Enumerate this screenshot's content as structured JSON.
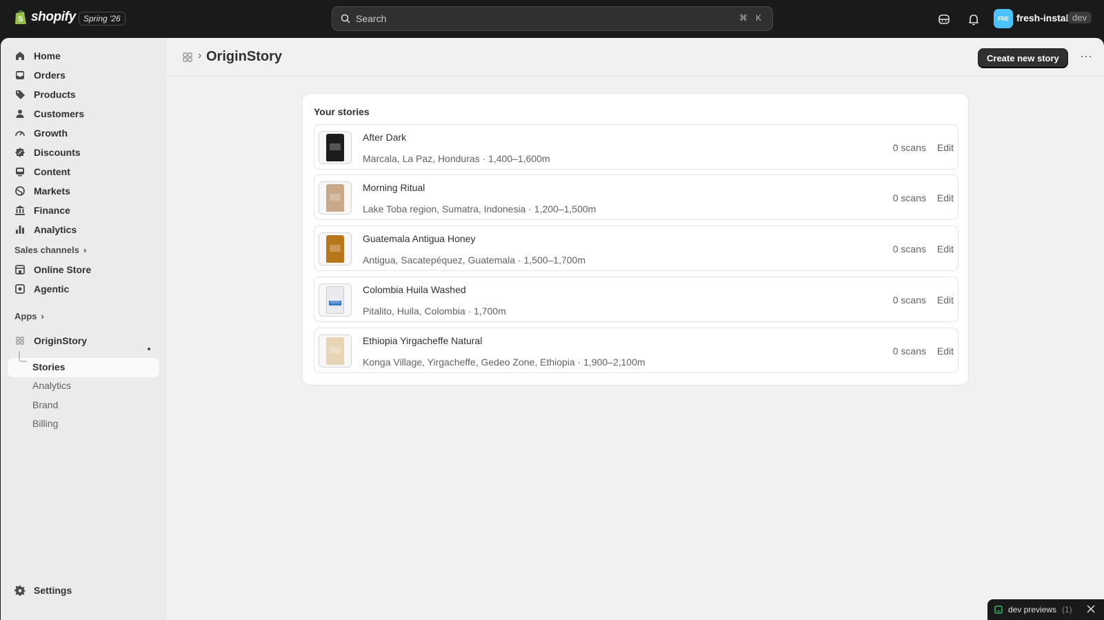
{
  "topbar": {
    "logo_text": "shopify",
    "edition": "Spring '26",
    "search_placeholder": "Search",
    "shortcut_cmd": "⌘",
    "shortcut_key": "K",
    "avatar_initials": "FRE",
    "store_name": "fresh-install",
    "store_badge": "dev",
    "avatar_color": "#4cc3ff"
  },
  "sidebar": {
    "items": [
      {
        "label": "Home",
        "icon": "home-icon"
      },
      {
        "label": "Orders",
        "icon": "inbox-icon"
      },
      {
        "label": "Products",
        "icon": "tag-icon"
      },
      {
        "label": "Customers",
        "icon": "person-icon"
      },
      {
        "label": "Growth",
        "icon": "gauge-icon"
      },
      {
        "label": "Discounts",
        "icon": "discount-icon"
      },
      {
        "label": "Content",
        "icon": "content-icon"
      },
      {
        "label": "Markets",
        "icon": "globe-icon"
      },
      {
        "label": "Finance",
        "icon": "bank-icon"
      },
      {
        "label": "Analytics",
        "icon": "bar-chart-icon"
      }
    ],
    "sales_channels_label": "Sales channels",
    "channels": [
      {
        "label": "Online Store",
        "icon": "store-icon"
      },
      {
        "label": "Agentic",
        "icon": "agentic-icon"
      }
    ],
    "apps_label": "Apps",
    "app_name": "OriginStory",
    "app_subitems": [
      "Stories",
      "Analytics",
      "Brand",
      "Billing"
    ],
    "settings_label": "Settings"
  },
  "header": {
    "title": "OriginStory",
    "separator": "›",
    "primary_action": "Create new story",
    "more": "···"
  },
  "stories": {
    "title": "Your stories",
    "rows": [
      {
        "name": "After Dark",
        "origin": "Marcala, La Paz, Honduras · 1,400–1,600m",
        "scans": "0 scans",
        "edit": "Edit",
        "bag_color": "#1c1c1c"
      },
      {
        "name": "Morning Ritual",
        "origin": "Lake Toba region, Sumatra, Indonesia · 1,200–1,500m",
        "scans": "0 scans",
        "edit": "Edit",
        "bag_color": "#c8a888"
      },
      {
        "name": "Guatemala Antigua Honey",
        "origin": "Antigua, Sacatepéquez, Guatemala · 1,500–1,700m",
        "scans": "0 scans",
        "edit": "Edit",
        "bag_color": "#b8761a"
      },
      {
        "name": "Colombia Huila Washed",
        "origin": "Pitalito, Huila, Colombia · 1,700m",
        "scans": "0 scans",
        "edit": "Edit",
        "bag_color": "#e8eaee"
      },
      {
        "name": "Ethiopia Yirgacheffe Natural",
        "origin": "Konga Village, Yirgacheffe, Gedeo Zone, Ethiopia · 1,900–2,100m",
        "scans": "0 scans",
        "edit": "Edit",
        "bag_color": "#e6d4b4"
      }
    ]
  },
  "toast": {
    "label": "dev previews",
    "count": "(1)"
  }
}
